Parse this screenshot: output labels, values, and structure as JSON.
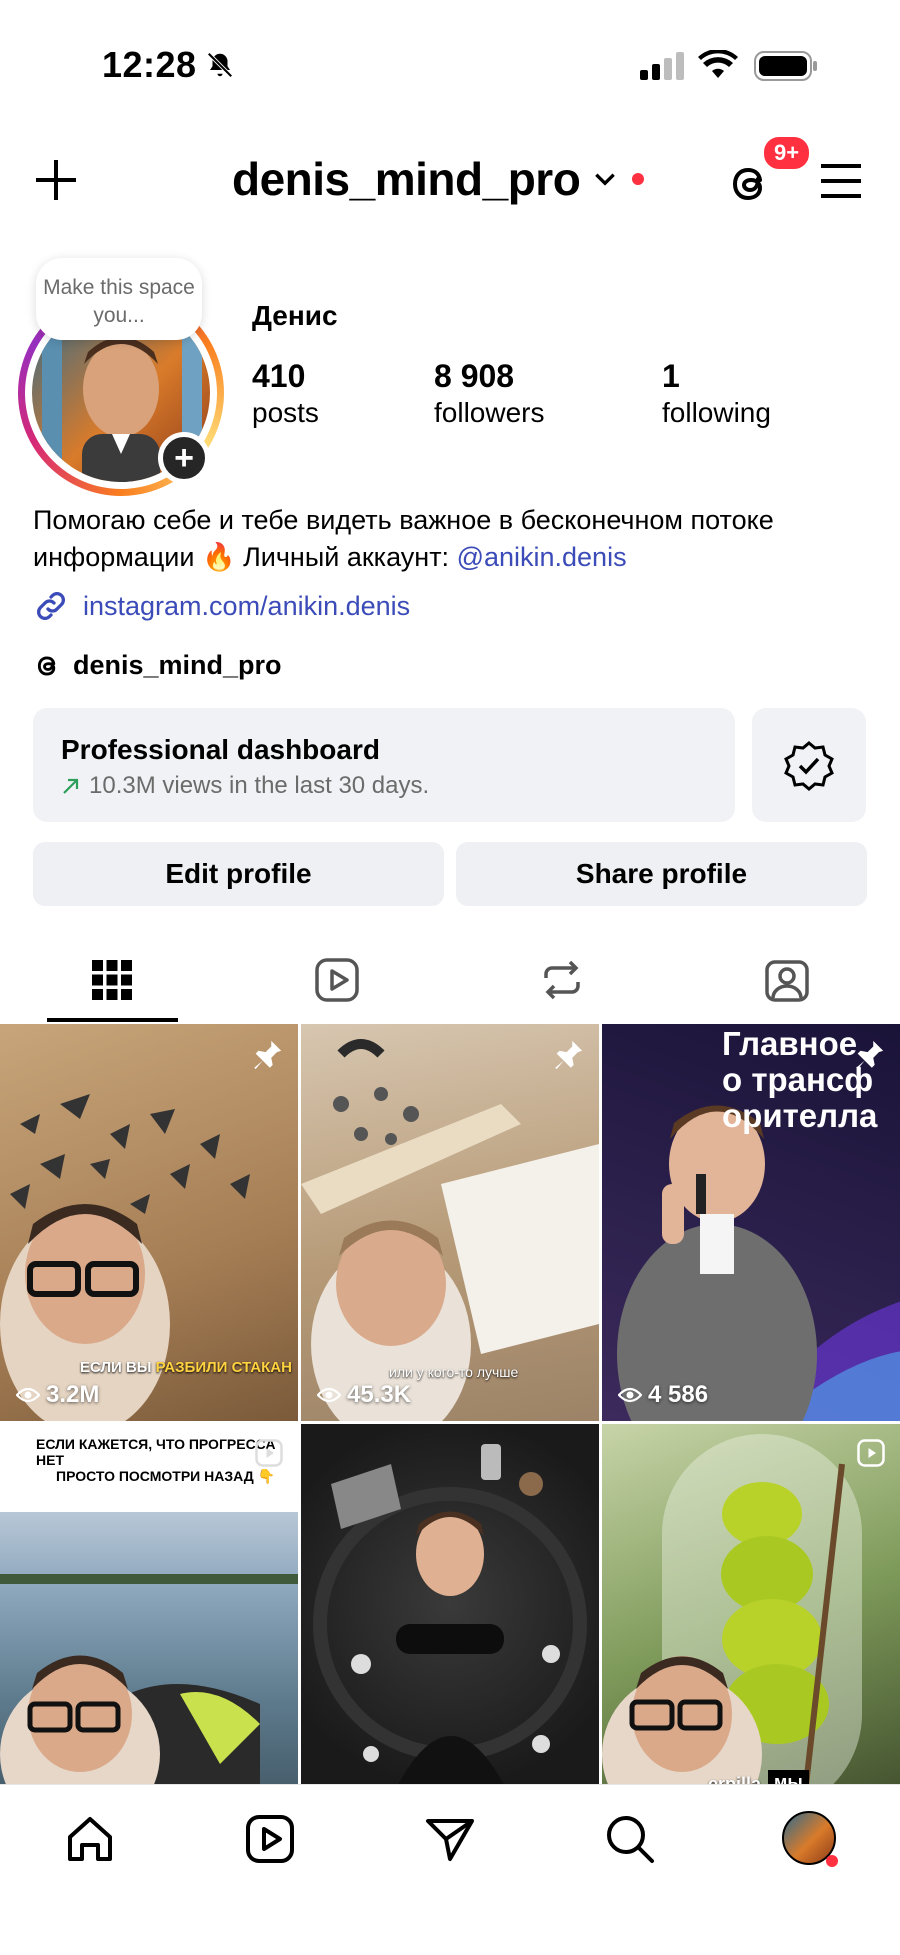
{
  "status_bar": {
    "time": "12:28"
  },
  "header": {
    "username": "denis_mind_pro",
    "notification_badge": "9+"
  },
  "profile": {
    "note_placeholder": "Make this space you...",
    "display_name": "Денис",
    "stats": [
      {
        "value": "410",
        "label": "posts"
      },
      {
        "value": "8 908",
        "label": "followers"
      },
      {
        "value": "1",
        "label": "following"
      }
    ],
    "bio_text": "Помогаю себе и тебе видеть важное в бесконечном потоке информации 🔥 Личный аккаунт: ",
    "bio_mention": "@anikin.denis",
    "link": "instagram.com/anikin.denis",
    "threads_handle": "denis_mind_pro"
  },
  "dashboard": {
    "title": "Professional dashboard",
    "subtitle": "10.3M views in the last 30 days."
  },
  "actions": {
    "edit": "Edit profile",
    "share": "Share profile"
  },
  "grid": {
    "tiles": [
      {
        "views": "3.2M",
        "caption_plain": "ЕСЛИ ВЫ ",
        "caption_highlight": "РАЗБИЛИ СТАКАН",
        "pinned": true
      },
      {
        "views": "45.3K",
        "caption_plain": "или у кого-то лучше",
        "pinned": true
      },
      {
        "views": "4 586",
        "overlay": "Главное\nо трансф\nорителла",
        "pinned": true
      },
      {
        "caption_top_1": "ЕСЛИ КАЖЕТСЯ, ЧТО ПРОГРЕССА НЕТ",
        "caption_top_2": "ПРОСТО ПОСМОТРИ НАЗАД 👇",
        "reel": true
      },
      {
        "reel": false
      },
      {
        "caption_bottom": "erpilla",
        "caption_tag": "мы",
        "reel": true
      }
    ]
  },
  "colors": {
    "accent_link": "#3b4bb8",
    "badge": "#ff3040",
    "button_bg": "#eef0f3"
  },
  "icons": [
    "plus-icon",
    "chevron-down-icon",
    "threads-icon",
    "menu-icon",
    "link-icon",
    "verified-badge-icon",
    "grid-icon",
    "reels-icon",
    "reposts-icon",
    "tagged-icon",
    "home-icon",
    "play-icon",
    "send-icon",
    "search-icon",
    "pin-icon",
    "eye-icon"
  ]
}
